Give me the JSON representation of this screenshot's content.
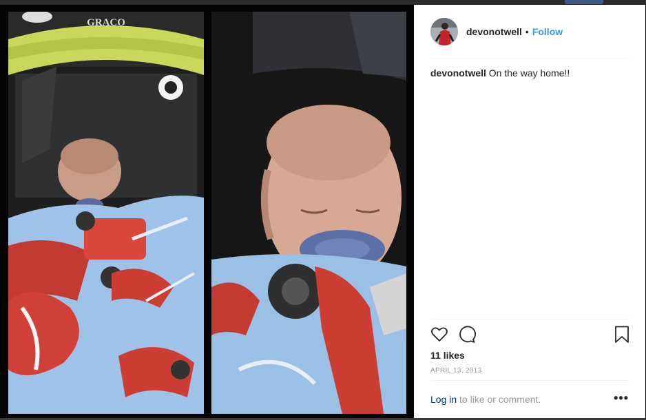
{
  "post": {
    "username": "devonotwell",
    "separator": "•",
    "follow_label": "Follow",
    "caption_user": "devonotwell",
    "caption_text": "On the way home!!",
    "likes": "11 likes",
    "date": "APRIL 13, 2013",
    "login_label": "Log in",
    "login_suffix": "to like or comment.",
    "more_label": "•••"
  },
  "photo": {
    "seat_brand": "GRACO"
  },
  "icons": {
    "like": "heart-icon",
    "comment": "comment-icon",
    "save": "bookmark-icon",
    "more": "more-options-icon"
  },
  "colors": {
    "follow": "#3897f0",
    "login": "#003569",
    "text": "#262626",
    "muted": "#999999"
  }
}
